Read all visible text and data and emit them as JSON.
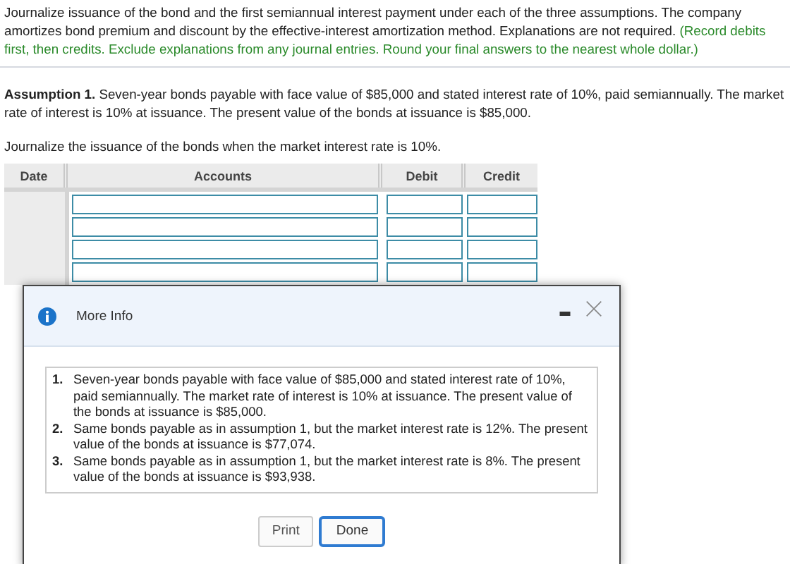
{
  "instructions": {
    "text": "Journalize issuance of the bond and the first semiannual interest payment under each of the three assumptions. The company amortizes bond premium and discount by the effective-interest amortization method. Explanations are not required.",
    "note": "(Record debits first, then credits. Exclude explanations from any journal entries. Round your final answers to the nearest whole dollar.)"
  },
  "assumption": {
    "label": "Assumption 1.",
    "text": "Seven-year bonds payable with face value of $85,000 and stated interest rate of 10%, paid semiannually. The market rate of interest is 10% at issuance. The present value of the bonds at issuance is $85,000."
  },
  "prompt": "Journalize the issuance of the bonds when the market interest rate is 10%.",
  "table": {
    "columns": [
      "Date",
      "Accounts",
      "Debit",
      "Credit"
    ],
    "rows": [
      {
        "kind": "entry"
      },
      {
        "kind": "entry"
      },
      {
        "kind": "entry"
      },
      {
        "kind": "entry"
      }
    ]
  },
  "dialog": {
    "title": "More Info",
    "items": [
      {
        "number": "1.",
        "text": "Seven-year bonds payable with face value of $85,000 and stated interest rate of 10%, paid semiannually. The market rate of interest is 10% at issuance. The present value of the bonds at issuance is $85,000."
      },
      {
        "number": "2.",
        "text": "Same bonds payable as in assumption 1, but the market interest rate is 12%. The present value of the bonds at issuance is $77,074."
      },
      {
        "number": "3.",
        "text": "Same bonds payable as in assumption 1, but the market interest rate is 8%. The present value of the bonds at issuance is $93,938."
      }
    ],
    "buttons": [
      {
        "label": "Print",
        "selected": false
      },
      {
        "label": "Done",
        "selected": true
      }
    ]
  }
}
